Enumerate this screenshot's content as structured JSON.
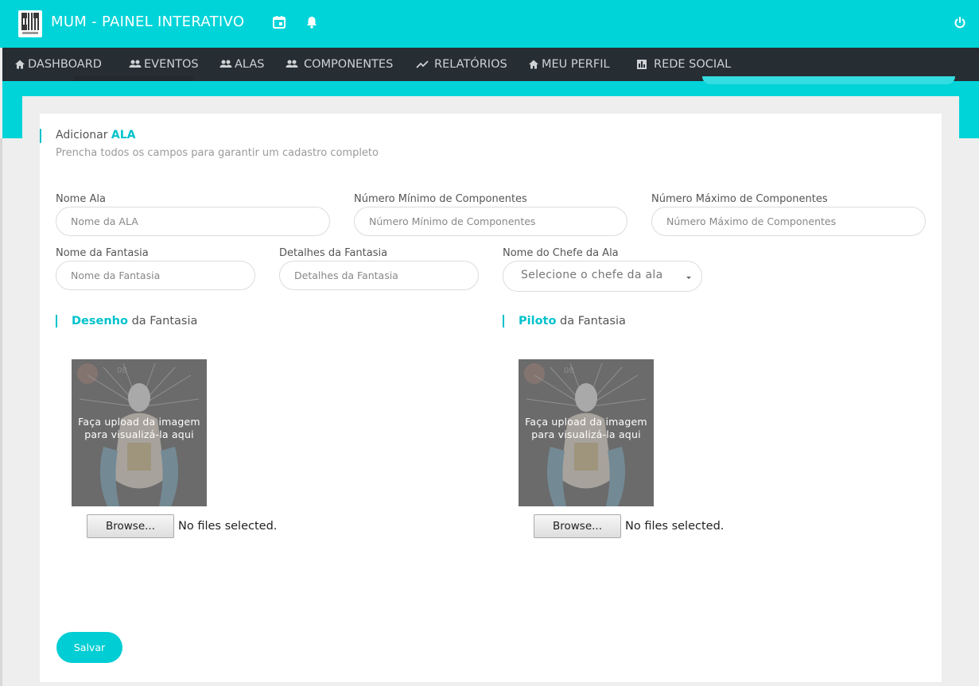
{
  "app": {
    "title": "MUM - PAINEL INTERATIVO"
  },
  "nav": {
    "items": [
      {
        "label": "DASHBOARD",
        "icon": "home-icon"
      },
      {
        "label": "EVENTOS",
        "icon": "people-icon"
      },
      {
        "label": "ALAS",
        "icon": "people-icon"
      },
      {
        "label": "COMPONENTES",
        "icon": "people-icon"
      },
      {
        "label": "RELATÓRIOS",
        "icon": "trending-icon"
      },
      {
        "label": "MEU PERFIL",
        "icon": "home-icon"
      },
      {
        "label": "REDE SOCIAL",
        "icon": "chart-icon"
      }
    ]
  },
  "form": {
    "title_prefix": "Adicionar",
    "title_accent": "ALA",
    "subtitle": "Prencha todos os campos para garantir um cadastro completo",
    "fields": {
      "nome_ala": {
        "label": "Nome Ala",
        "placeholder": "Nome da ALA"
      },
      "min": {
        "label": "Número Mínimo de Componentes",
        "placeholder": "Número Mínimo de Componentes"
      },
      "max": {
        "label": "Número Máximo de Componentes",
        "placeholder": "Número Máximo de Componentes"
      },
      "fantasia": {
        "label": "Nome da Fantasia",
        "placeholder": "Nome da Fantasia"
      },
      "detalhes": {
        "label": "Detalhes da Fantasia",
        "placeholder": "Detalhes da Fantasia"
      },
      "chefe": {
        "label": "Nome do Chefe da Ala",
        "selected": "Selecione o chefe da ala"
      }
    },
    "desenho": {
      "accent": "Desenho",
      "rest": "da Fantasia",
      "preview_line1": "Faça upload da imagem",
      "preview_line2": "para visualizá-la aqui",
      "browse": "Browse...",
      "status": "No files selected."
    },
    "piloto": {
      "accent": "Piloto",
      "rest": "da Fantasia",
      "preview_line1": "Faça upload da imagem",
      "preview_line2": "para visualizá-la aqui",
      "browse": "Browse...",
      "status": "No files selected."
    },
    "submit": "Salvar"
  },
  "colors": {
    "accent": "#00d4d9",
    "nav_bg": "#262d33"
  }
}
